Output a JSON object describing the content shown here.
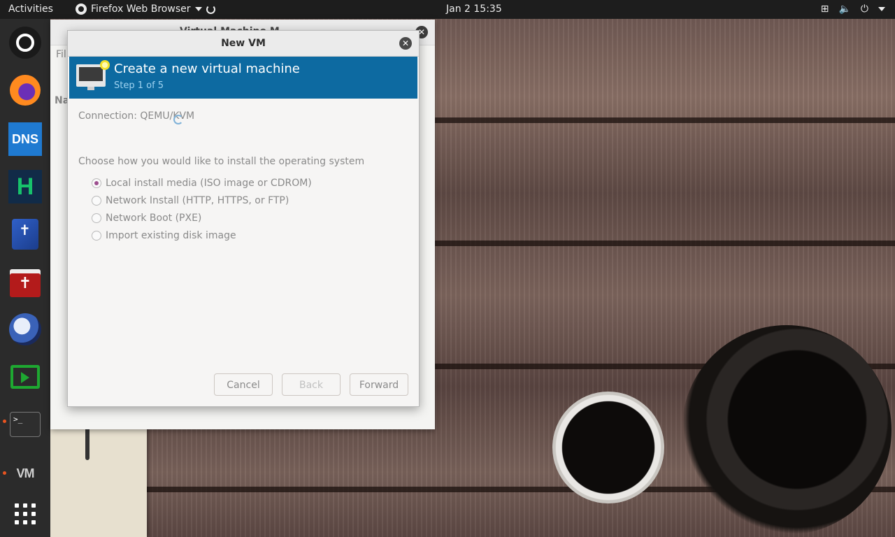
{
  "topbar": {
    "activities": "Activities",
    "app_name": "Firefox Web Browser",
    "clock": "Jan 2  15:35"
  },
  "dock": {
    "items": [
      "ubuntu-icon",
      "firefox-icon",
      "dns-icon",
      "h-app-icon",
      "bible-app-icon",
      "red-book-icon",
      "globe-app-icon",
      "green-screen-icon",
      "terminal-icon",
      "virt-manager-icon",
      "show-apps-icon"
    ],
    "dns_text": "DNS",
    "h_text": "H",
    "term_text": ">_",
    "vmm_text": "VM"
  },
  "background_window": {
    "title": "Virtual Machine M",
    "menu_fragment": "Fil",
    "name_fragment": "Na"
  },
  "dialog": {
    "title": "New VM",
    "banner_title": "Create a new virtual machine",
    "banner_step": "Step 1 of 5",
    "connection_label": "Connection:  QEMU/KVM",
    "install_prompt": "Choose how you would like to install the operating system",
    "options": [
      {
        "label": "Local install media (ISO image or CDROM)",
        "selected": true
      },
      {
        "label": "Network Install (HTTP, HTTPS, or FTP)",
        "selected": false
      },
      {
        "label": "Network Boot (PXE)",
        "selected": false
      },
      {
        "label": "Import existing disk image",
        "selected": false
      }
    ],
    "buttons": {
      "cancel": "Cancel",
      "back": "Back",
      "forward": "Forward"
    }
  },
  "colors": {
    "banner": "#0d6aa1",
    "banner_step": "#9ed2f0",
    "radio_selected": "#9d4f8e",
    "topbar": "#1d1d1d",
    "dock": "#2b2b2b"
  }
}
